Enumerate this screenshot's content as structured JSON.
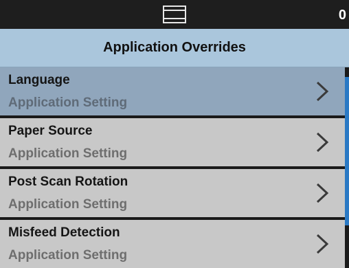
{
  "status_bar": {
    "icon": "scanner-tray-icon",
    "count": "0"
  },
  "header": {
    "title": "Application Overrides"
  },
  "list": {
    "items": [
      {
        "label": "Language",
        "sublabel": "Application Setting",
        "selected": true,
        "icon": "chevron-right-icon"
      },
      {
        "label": "Paper Source",
        "sublabel": "Application Setting",
        "selected": false,
        "icon": "chevron-right-icon"
      },
      {
        "label": "Post Scan Rotation",
        "sublabel": "Application Setting",
        "selected": false,
        "icon": "chevron-right-icon"
      },
      {
        "label": "Misfeed Detection",
        "sublabel": "Application Setting",
        "selected": false,
        "icon": "chevron-right-icon"
      }
    ]
  },
  "colors": {
    "status_bar": "#1e1e1e",
    "title_bar": "#aac6dc",
    "item": "#c8c8c8",
    "item_selected": "#90a6bc",
    "scroll_thumb": "#2a79c4"
  }
}
